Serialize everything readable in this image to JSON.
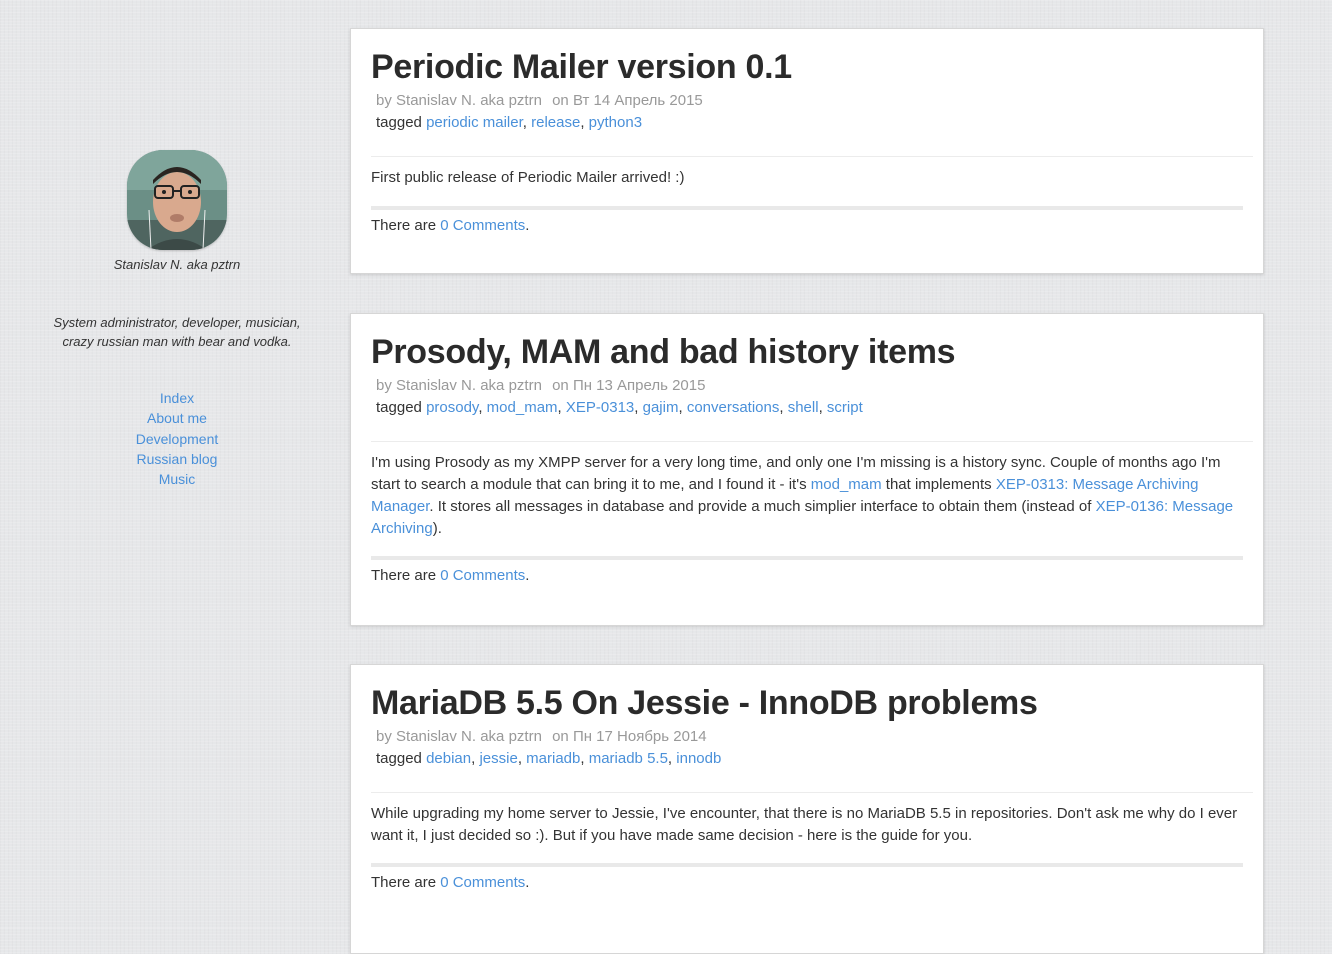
{
  "sidebar": {
    "author_name": "Stanislav N. aka pztrn",
    "bio": "System administrator, developer, musician, crazy russian man with bear and vodka.",
    "nav": [
      "Index",
      "About me",
      "Development",
      "Russian blog",
      "Music"
    ]
  },
  "posts": [
    {
      "title": "Periodic Mailer version 0.1",
      "by_label": "by",
      "author": "Stanislav N. aka pztrn",
      "on_label": "on",
      "date": "Вт 14 Апрель 2015",
      "tagged_label": "tagged",
      "tags": [
        "periodic mailer",
        "release",
        "python3"
      ],
      "body": "First public release of Periodic Mailer arrived! :)",
      "comments_prefix": "There are",
      "comments_link": "0 Comments",
      "comments_suffix": "."
    },
    {
      "title": "Prosody, MAM and bad history items",
      "by_label": "by",
      "author": "Stanislav N. aka pztrn",
      "on_label": "on",
      "date": "Пн 13 Апрель 2015",
      "tagged_label": "tagged",
      "tags": [
        "prosody",
        "mod_mam",
        "XEP-0313",
        "gajim",
        "conversations",
        "shell",
        "script"
      ],
      "body_parts": {
        "p1": "I'm using Prosody as my XMPP server for a very long time, and only one I'm missing is a history sync. Couple of months ago I'm start to search a module that can bring it to me, and I found it - it's ",
        "l1": "mod_mam",
        "p2": " that implements ",
        "l2": "XEP-0313: Message Archiving Manager",
        "p3": ". It stores all messages in database and provide a much simplier interface to obtain them (instead of ",
        "l3": "XEP-0136: Message Archiving",
        "p4": ")."
      },
      "comments_prefix": "There are",
      "comments_link": "0 Comments",
      "comments_suffix": "."
    },
    {
      "title": "MariaDB 5.5 On Jessie - InnoDB problems",
      "by_label": "by",
      "author": "Stanislav N. aka pztrn",
      "on_label": "on",
      "date": "Пн 17 Ноябрь 2014",
      "tagged_label": "tagged",
      "tags": [
        "debian",
        "jessie",
        "mariadb",
        "mariadb 5.5",
        "innodb"
      ],
      "body": "While upgrading my home server to Jessie, I've encounter, that there is no MariaDB 5.5 in repositories. Don't ask me why do I ever want it, I just decided so :). But if you have made same decision - here is the guide for you.",
      "comments_prefix": "There are",
      "comments_link": "0 Comments",
      "comments_suffix": "."
    }
  ],
  "colors": {
    "link": "#4a90d9",
    "text": "#333333",
    "meta": "#999999",
    "background": "#e6e7e9"
  }
}
